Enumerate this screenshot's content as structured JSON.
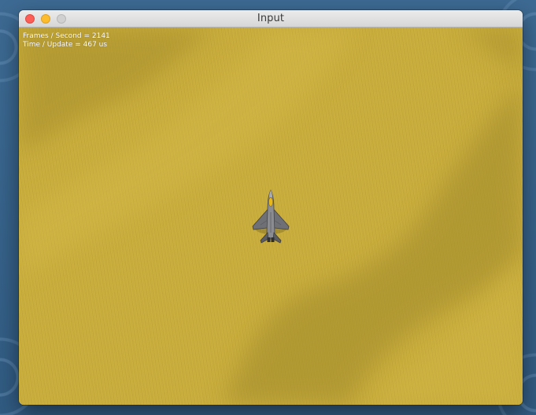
{
  "window": {
    "title": "Input"
  },
  "hud": {
    "fps_line": "Frames / Second = 2141",
    "update_line": "Time / Update = 467 us"
  },
  "icons": {
    "close": "close-button-red",
    "minimize": "minimize-button-yellow",
    "zoom": "zoom-button-gray",
    "player": "fighter-jet-sprite"
  },
  "colors": {
    "sand": "#c8ac3c",
    "shadow_band": "#a8902e",
    "desktop": "#3d6a93"
  }
}
